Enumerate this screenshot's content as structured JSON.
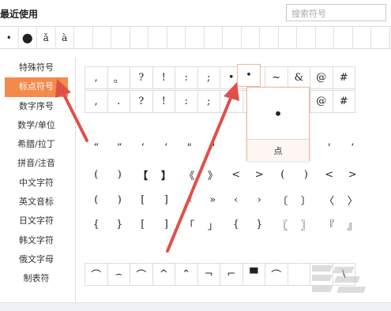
{
  "header": {
    "recent_title": "最近使用",
    "search_placeholder": "搜索符号"
  },
  "recent_symbols": [
    "•",
    "●",
    "ǎ",
    "à",
    "",
    "",
    "",
    "",
    "",
    "",
    "",
    "",
    "",
    "",
    "",
    "",
    "",
    "",
    "",
    "",
    ""
  ],
  "sidebar": {
    "items": [
      {
        "label": "特殊符号"
      },
      {
        "label": "标点符号",
        "active": true
      },
      {
        "label": "数字序号"
      },
      {
        "label": "数学/单位"
      },
      {
        "label": "希腊/拉丁"
      },
      {
        "label": "拼音/注音"
      },
      {
        "label": "中文字符"
      },
      {
        "label": "英文音标"
      },
      {
        "label": "日文字符"
      },
      {
        "label": "韩文字符"
      },
      {
        "label": "俄文字母"
      },
      {
        "label": "制表符"
      }
    ]
  },
  "symbol_rows": [
    [
      ",",
      "。",
      "?",
      "!",
      ":",
      ";",
      "•",
      "···",
      "~",
      "&",
      "@",
      "#"
    ],
    [
      ",",
      ".",
      "?",
      "!",
      ":",
      ";",
      "",
      "",
      "",
      "&",
      "@",
      "#"
    ],
    [
      "“",
      "”",
      "‘",
      "’",
      "\"",
      "\"",
      "",
      "",
      "",
      "'",
      "'",
      "‘"
    ],
    [
      "(",
      ")",
      "【",
      "】",
      "《",
      "》",
      "<",
      ">",
      "(",
      ")",
      "<",
      ">"
    ],
    [
      "(",
      ")",
      "[",
      "]",
      "«",
      "»",
      "‹",
      "›",
      "〔",
      "〕",
      "〈",
      "〉"
    ],
    [
      "{",
      "}",
      "[",
      "]",
      "「",
      "」",
      "{",
      "}",
      "〖",
      "〗",
      "『",
      "』"
    ]
  ],
  "table_symbols": [
    "⌒",
    "⌢",
    "⌒",
    "^",
    "⌃",
    "¬",
    "⌐",
    "▀",
    "⌒",
    "",
    "",
    "\\"
  ],
  "popup": {
    "symbol": "•",
    "name": "点"
  },
  "colors": {
    "active_item": "#f48a4b",
    "arrow": "#e0504a"
  }
}
